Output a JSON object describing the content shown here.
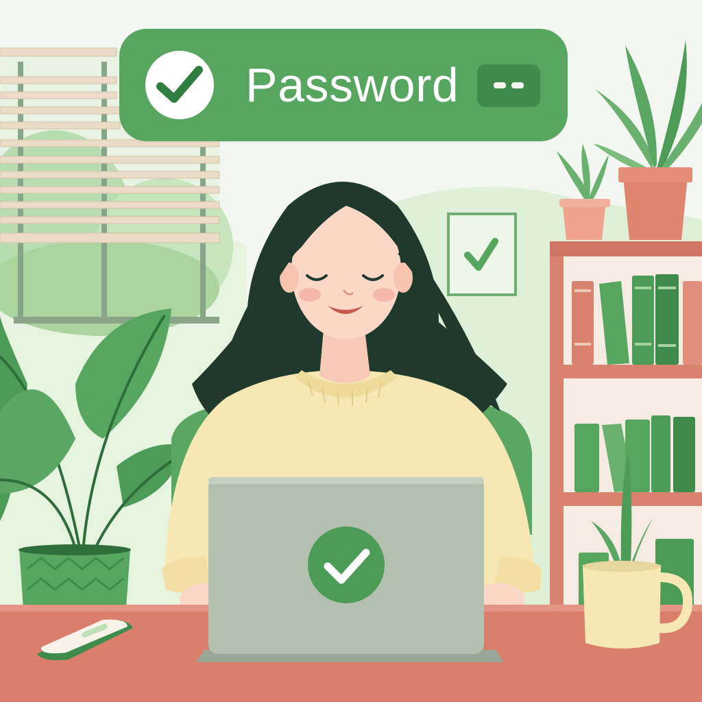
{
  "banner": {
    "label": "Password",
    "status_icon": "checkmark-icon",
    "visibility_icon": "hide-password-icon"
  },
  "laptop": {
    "status_icon": "checkmark-icon"
  },
  "wall_frame": {
    "icon": "checkmark-icon"
  },
  "colors": {
    "primary_green": "#56a65f",
    "dark_green": "#3f8b4b",
    "sweater": "#f6e7b4",
    "desk": "#d97f6b",
    "shelf": "#d9836e",
    "laptop": "#b3c0b0",
    "hair": "#1f3a2c"
  }
}
